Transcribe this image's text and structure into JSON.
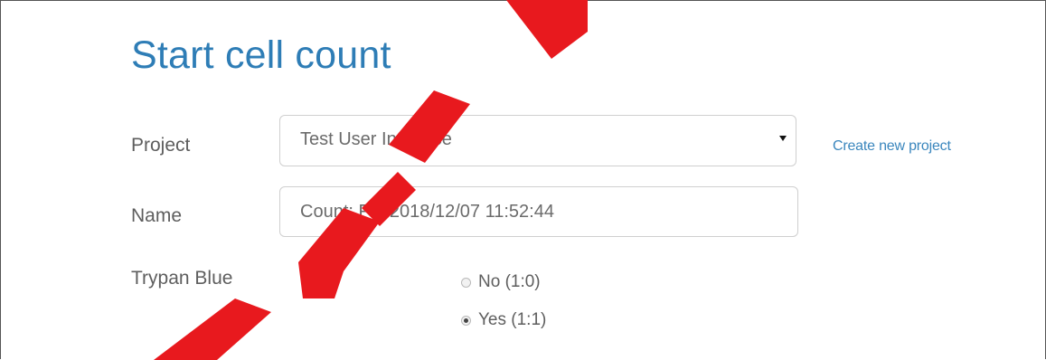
{
  "form": {
    "title": "Start cell count",
    "project_label": "Project",
    "project_value": "Test User Interface",
    "create_project_link": "Create new project",
    "name_label": "Name",
    "name_value": "Count: Fri, 2018/12/07 11:52:44",
    "trypan_label": "Trypan Blue",
    "trypan_options": [
      {
        "label": "No (1:0)",
        "checked": false
      },
      {
        "label": "Yes (1:1)",
        "checked": true
      }
    ]
  },
  "colors": {
    "title": "#2e7db6",
    "link": "#3a86bd",
    "watermark": "#e8191e"
  }
}
